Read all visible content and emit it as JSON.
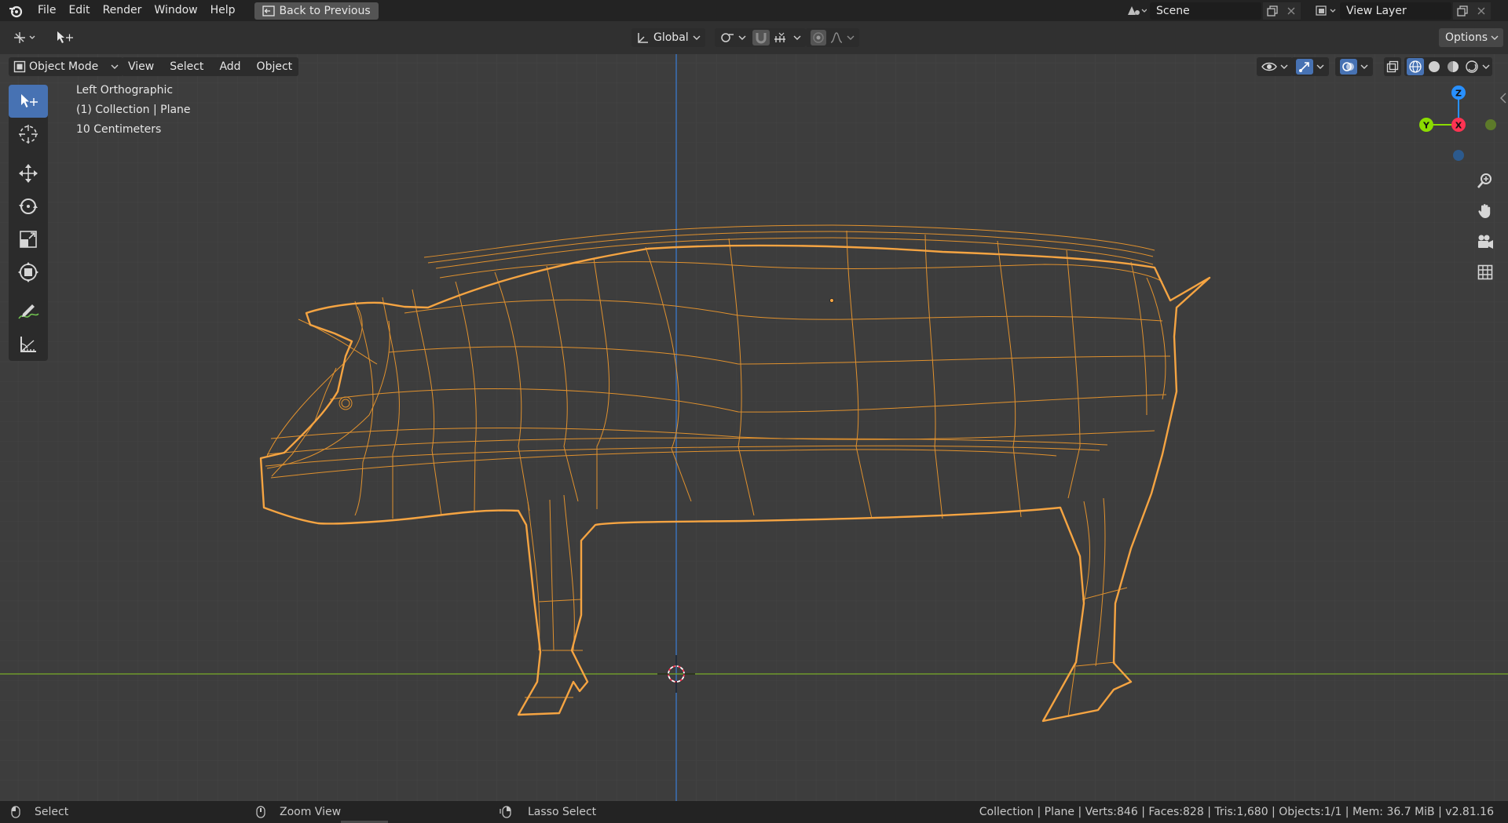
{
  "menu": {
    "items": [
      {
        "label": "File"
      },
      {
        "label": "Edit"
      },
      {
        "label": "Render"
      },
      {
        "label": "Window"
      },
      {
        "label": "Help"
      }
    ],
    "back_label": "Back to Previous"
  },
  "scene": {
    "name": "Scene"
  },
  "view_layer": {
    "name": "View Layer"
  },
  "tool_header": {
    "orientation": "Global",
    "options_label": "Options"
  },
  "viewport_header": {
    "mode": "Object Mode",
    "menus": [
      {
        "label": "View"
      },
      {
        "label": "Select"
      },
      {
        "label": "Add"
      },
      {
        "label": "Object"
      }
    ]
  },
  "viewport_info": {
    "view_name": "Left Orthographic",
    "collection": "(1) Collection | Plane",
    "scale": "10 Centimeters"
  },
  "gizmo": {
    "z": "Z",
    "y": "Y",
    "x": "X"
  },
  "statusbar": {
    "left": "Select",
    "middle": "Zoom View",
    "right": "Lasso Select",
    "stats": "Collection | Plane | Verts:846 | Faces:828 | Tris:1,680 | Objects:1/1 | Mem: 36.7 MiB | v2.81.16"
  },
  "colors": {
    "selection": "#f5a442",
    "active_tool": "#4772b3",
    "x_axis": "#ff3352",
    "y_axis": "#8bdc00",
    "z_axis": "#2890ff"
  }
}
